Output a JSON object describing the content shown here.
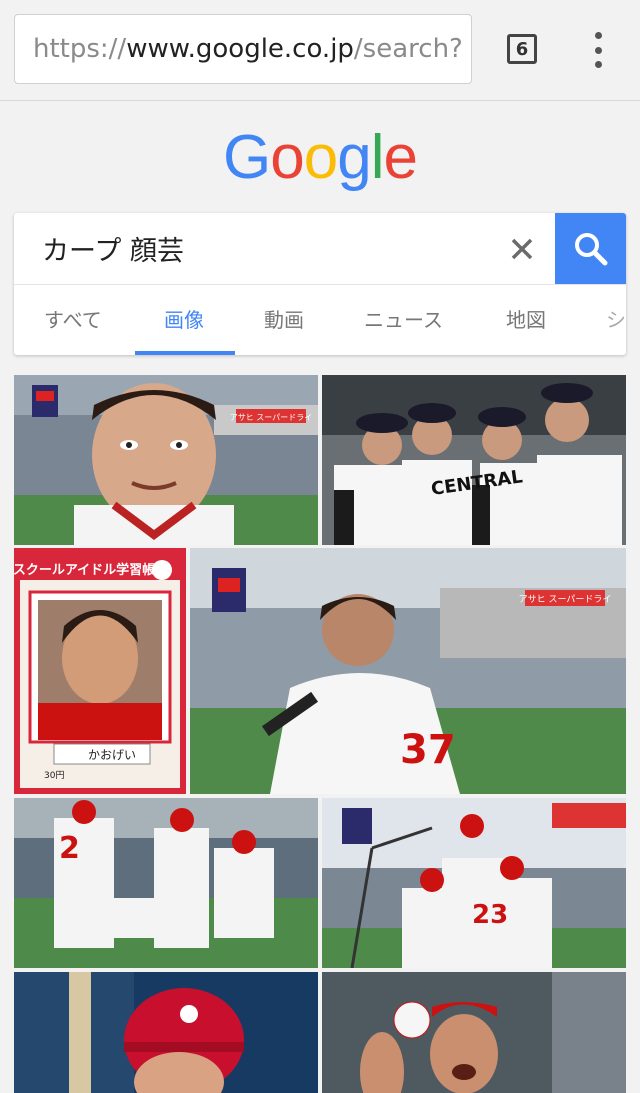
{
  "browser": {
    "url_scheme": "https://",
    "url_host": "www.google.co.jp",
    "url_rest": "/search?",
    "tab_count": "6",
    "menu_icon": "more-vert-icon"
  },
  "logo": {
    "letters": [
      "G",
      "o",
      "o",
      "g",
      "l",
      "e"
    ],
    "colors": [
      "#4285f4",
      "#ea4335",
      "#fbbc05",
      "#4285f4",
      "#34a853",
      "#ea4335"
    ]
  },
  "search": {
    "query": "カープ 顔芸",
    "clear_icon": "close-icon",
    "search_icon": "search-icon",
    "accent": "#4285f4"
  },
  "tabs": {
    "items": [
      {
        "label": "すべて"
      },
      {
        "label": "画像"
      },
      {
        "label": "動画"
      },
      {
        "label": "ニュース"
      },
      {
        "label": "地図"
      },
      {
        "label": "シ"
      }
    ],
    "active_index": 1
  },
  "results": {
    "items": [
      {
        "overlay_text": "アサヒ スーパードライ"
      },
      {
        "overlay_text": "CENTRAL"
      },
      {
        "title": "スクールアイドル学習帳",
        "caption": "かおげい",
        "price": "30円"
      },
      {
        "overlay_text": "アサヒ スーパードライ",
        "jersey": "37"
      },
      {
        "jersey": "2"
      },
      {
        "jersey": "23"
      },
      {},
      {}
    ]
  }
}
